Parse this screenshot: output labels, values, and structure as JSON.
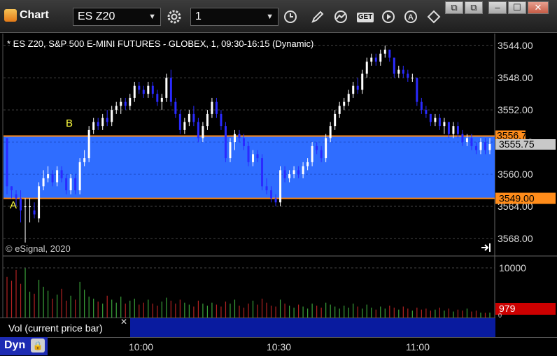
{
  "toolbar": {
    "title": "Chart",
    "symbol": "ES Z20",
    "interval": "1",
    "icons": [
      "gear-icon",
      "clock-icon",
      "pencil-icon",
      "line-icon",
      "get-icon",
      "play-icon",
      "a-icon",
      "sync-icon"
    ],
    "get_label": "GET",
    "a_label": "A",
    "window_buttons": [
      "restore-icon",
      "restore-icon",
      "minimize-icon",
      "maximize-icon",
      "close-icon"
    ]
  },
  "chart": {
    "header": "* ES Z20, S&P 500 E-MINI FUTURES - GLOBEX, 1, 09:30-16:15 (Dynamic)",
    "copyright": "© eSignal, 2020",
    "marker_a": "A",
    "marker_b": "B",
    "price_labels": [
      "3568.00",
      "3564.00",
      "3560.00",
      "3556.00",
      "3552.00",
      "3548.00",
      "3544.00"
    ],
    "level_high": "3556.75",
    "level_low": "3549.00",
    "last_price": "3555.75",
    "volume_scale": "10000",
    "volume_value": "979",
    "volume_zero": "0",
    "colors": {
      "up": "#ffffff",
      "down": "#2a2aff",
      "zone": "#2f6dff",
      "level": "#ff8c1a",
      "vol_up": "#3aa23a",
      "vol_down": "#b22222"
    }
  },
  "chart_data": {
    "type": "bar",
    "xlabel": "",
    "ylabel": "",
    "ylim": [
      3542,
      3569.5
    ],
    "x_ticks": [
      "10:00",
      "10:30",
      "11:00"
    ],
    "y_ticks": [
      3544,
      3548,
      3552,
      3556,
      3560,
      3564,
      3568
    ],
    "levels": [
      3556.75,
      3549.0
    ],
    "last": 3555.75,
    "volume_ylim": [
      0,
      10000
    ],
    "volume_last": 979,
    "candles_ohlc": [
      [
        3556.5,
        3556.5,
        3549.5,
        3550.5
      ],
      [
        3550.5,
        3550.5,
        3549.0,
        3550.0
      ],
      [
        3549.5,
        3550.0,
        3548.0,
        3549.0
      ],
      [
        3549.0,
        3550.0,
        3546.0,
        3547.5
      ],
      [
        3548.0,
        3549.0,
        3543.5,
        3548.0
      ],
      [
        3548.0,
        3549.0,
        3546.0,
        3548.0
      ],
      [
        3547.5,
        3548.5,
        3546.5,
        3547.0
      ],
      [
        3546.5,
        3551.0,
        3546.0,
        3550.5
      ],
      [
        3550.5,
        3552.5,
        3550.0,
        3551.5
      ],
      [
        3551.5,
        3553.0,
        3551.0,
        3552.0
      ],
      [
        3552.0,
        3552.5,
        3550.5,
        3551.0
      ],
      [
        3551.0,
        3553.0,
        3550.5,
        3552.5
      ],
      [
        3552.5,
        3553.0,
        3551.0,
        3551.5
      ],
      [
        3551.5,
        3552.0,
        3549.5,
        3550.0
      ],
      [
        3550.0,
        3552.0,
        3549.5,
        3551.5
      ],
      [
        3551.5,
        3552.0,
        3549.5,
        3550.0
      ],
      [
        3550.0,
        3554.0,
        3549.5,
        3553.5
      ],
      [
        3553.5,
        3555.0,
        3553.0,
        3554.0
      ],
      [
        3554.0,
        3558.0,
        3553.5,
        3557.5
      ],
      [
        3557.5,
        3559.0,
        3557.0,
        3558.5
      ],
      [
        3558.5,
        3559.0,
        3557.5,
        3558.0
      ],
      [
        3558.0,
        3559.5,
        3557.5,
        3559.0
      ],
      [
        3559.0,
        3560.0,
        3558.0,
        3558.5
      ],
      [
        3558.5,
        3560.5,
        3558.0,
        3560.0
      ],
      [
        3560.0,
        3561.0,
        3559.5,
        3560.5
      ],
      [
        3560.5,
        3561.5,
        3559.5,
        3561.0
      ],
      [
        3561.0,
        3561.5,
        3560.0,
        3560.5
      ],
      [
        3560.5,
        3562.0,
        3560.0,
        3561.5
      ],
      [
        3561.5,
        3563.5,
        3561.0,
        3563.0
      ],
      [
        3563.0,
        3563.5,
        3562.0,
        3562.5
      ],
      [
        3562.5,
        3563.0,
        3561.5,
        3562.0
      ],
      [
        3562.0,
        3563.5,
        3561.5,
        3563.0
      ],
      [
        3563.0,
        3563.5,
        3561.5,
        3562.0
      ],
      [
        3562.0,
        3562.5,
        3560.5,
        3561.0
      ],
      [
        3561.0,
        3562.0,
        3560.0,
        3561.5
      ],
      [
        3561.5,
        3564.5,
        3561.0,
        3564.0
      ],
      [
        3564.0,
        3565.0,
        3560.5,
        3561.0
      ],
      [
        3561.0,
        3561.5,
        3559.0,
        3559.5
      ],
      [
        3559.5,
        3560.0,
        3557.0,
        3557.5
      ],
      [
        3557.5,
        3559.0,
        3557.0,
        3558.5
      ],
      [
        3558.5,
        3560.0,
        3558.0,
        3559.5
      ],
      [
        3559.5,
        3560.5,
        3558.0,
        3558.5
      ],
      [
        3558.5,
        3559.0,
        3556.0,
        3556.5
      ],
      [
        3556.5,
        3558.5,
        3556.0,
        3558.0
      ],
      [
        3558.0,
        3560.0,
        3557.5,
        3559.5
      ],
      [
        3559.5,
        3561.5,
        3559.0,
        3561.0
      ],
      [
        3561.0,
        3561.5,
        3559.0,
        3559.5
      ],
      [
        3559.5,
        3560.0,
        3557.5,
        3558.0
      ],
      [
        3558.0,
        3558.5,
        3553.5,
        3554.0
      ],
      [
        3554.0,
        3556.5,
        3553.5,
        3556.0
      ],
      [
        3556.0,
        3557.5,
        3555.0,
        3557.0
      ],
      [
        3557.0,
        3557.5,
        3556.0,
        3556.5
      ],
      [
        3556.5,
        3557.0,
        3555.0,
        3555.5
      ],
      [
        3555.5,
        3556.0,
        3553.0,
        3553.5
      ],
      [
        3553.5,
        3555.0,
        3553.0,
        3554.5
      ],
      [
        3554.5,
        3555.0,
        3553.5,
        3554.0
      ],
      [
        3554.0,
        3554.5,
        3550.0,
        3550.5
      ],
      [
        3550.5,
        3551.5,
        3549.5,
        3550.0
      ],
      [
        3550.0,
        3550.5,
        3548.5,
        3549.0
      ],
      [
        3549.0,
        3549.5,
        3548.0,
        3548.5
      ],
      [
        3548.5,
        3553.0,
        3548.0,
        3552.5
      ],
      [
        3552.5,
        3553.0,
        3551.0,
        3551.5
      ],
      [
        3551.5,
        3552.5,
        3551.0,
        3552.0
      ],
      [
        3552.0,
        3553.0,
        3551.5,
        3552.5
      ],
      [
        3552.5,
        3553.0,
        3551.5,
        3552.0
      ],
      [
        3552.0,
        3553.5,
        3551.5,
        3553.0
      ],
      [
        3553.0,
        3554.0,
        3552.5,
        3553.5
      ],
      [
        3553.5,
        3556.0,
        3553.0,
        3555.5
      ],
      [
        3555.5,
        3556.0,
        3554.5,
        3555.0
      ],
      [
        3555.0,
        3555.5,
        3553.5,
        3554.0
      ],
      [
        3554.0,
        3557.0,
        3553.5,
        3556.5
      ],
      [
        3556.5,
        3558.5,
        3556.0,
        3558.0
      ],
      [
        3558.0,
        3560.0,
        3557.5,
        3559.5
      ],
      [
        3559.5,
        3561.0,
        3559.0,
        3560.5
      ],
      [
        3560.5,
        3561.5,
        3560.0,
        3561.0
      ],
      [
        3561.0,
        3562.5,
        3560.5,
        3562.0
      ],
      [
        3562.0,
        3563.5,
        3561.5,
        3563.0
      ],
      [
        3563.0,
        3564.0,
        3562.0,
        3562.5
      ],
      [
        3562.5,
        3565.0,
        3562.0,
        3564.5
      ],
      [
        3564.5,
        3566.5,
        3564.0,
        3566.0
      ],
      [
        3566.0,
        3567.0,
        3565.5,
        3566.5
      ],
      [
        3566.5,
        3567.0,
        3565.5,
        3566.0
      ],
      [
        3566.0,
        3567.5,
        3565.5,
        3567.0
      ],
      [
        3567.0,
        3568.0,
        3566.5,
        3567.5
      ],
      [
        3567.5,
        3567.5,
        3566.0,
        3566.5
      ],
      [
        3566.5,
        3566.5,
        3564.0,
        3564.5
      ],
      [
        3564.5,
        3565.5,
        3564.0,
        3565.0
      ],
      [
        3565.0,
        3565.5,
        3564.0,
        3564.5
      ],
      [
        3564.5,
        3565.0,
        3563.5,
        3564.0
      ],
      [
        3564.0,
        3564.5,
        3563.5,
        3564.0
      ],
      [
        3564.0,
        3564.0,
        3560.5,
        3561.0
      ],
      [
        3561.0,
        3561.5,
        3559.5,
        3560.0
      ],
      [
        3560.0,
        3560.5,
        3559.0,
        3559.5
      ],
      [
        3559.5,
        3559.5,
        3558.0,
        3558.5
      ],
      [
        3558.5,
        3559.5,
        3558.0,
        3559.0
      ],
      [
        3559.0,
        3559.5,
        3557.5,
        3558.0
      ],
      [
        3558.0,
        3559.0,
        3557.0,
        3558.5
      ],
      [
        3558.5,
        3558.5,
        3556.5,
        3557.0
      ],
      [
        3557.0,
        3558.5,
        3556.5,
        3558.0
      ],
      [
        3558.0,
        3558.5,
        3556.5,
        3557.0
      ],
      [
        3557.0,
        3557.5,
        3555.5,
        3556.0
      ],
      [
        3556.0,
        3557.0,
        3555.5,
        3556.5
      ],
      [
        3556.5,
        3557.0,
        3555.0,
        3555.5
      ],
      [
        3555.5,
        3556.0,
        3554.5,
        3555.0
      ],
      [
        3555.0,
        3556.5,
        3554.5,
        3556.0
      ],
      [
        3556.0,
        3556.5,
        3554.5,
        3555.0
      ],
      [
        3555.0,
        3556.5,
        3554.5,
        3555.75
      ]
    ],
    "volumes": [
      8200,
      7400,
      9600,
      6800,
      10000,
      5200,
      4800,
      7600,
      6200,
      5400,
      3800,
      4600,
      5800,
      3400,
      4400,
      3600,
      7200,
      5600,
      4200,
      3800,
      3200,
      2800,
      4400,
      3600,
      3000,
      4200,
      2800,
      3400,
      3800,
      2600,
      3000,
      3600,
      2800,
      2400,
      3200,
      4000,
      3400,
      2800,
      3600,
      3000,
      2600,
      2200,
      3400,
      2800,
      2400,
      3000,
      2600,
      2200,
      3200,
      2800,
      3600,
      2400,
      2000,
      2800,
      3400,
      2600,
      3800,
      3000,
      2400,
      2200,
      3600,
      2800,
      2400,
      2000,
      2600,
      2200,
      1800,
      2800,
      2400,
      2000,
      3000,
      2600,
      2200,
      1800,
      2400,
      2000,
      2800,
      2200,
      1800,
      2600,
      2000,
      1600,
      2200,
      1800,
      2400,
      2000,
      1600,
      2200,
      1800,
      1400,
      2000,
      1600,
      1800,
      1400,
      1600,
      2000,
      1400,
      1800,
      1200,
      1600,
      1400,
      1800,
      1200,
      1400,
      1000,
      979,
      1000
    ]
  }
}
